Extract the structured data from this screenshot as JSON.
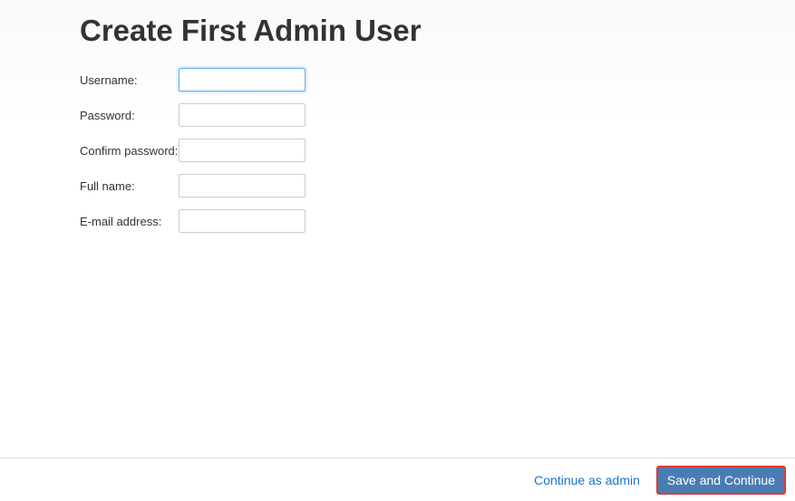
{
  "header": {
    "title": "Create First Admin User"
  },
  "form": {
    "fields": [
      {
        "label": "Username:",
        "value": "",
        "focused": true
      },
      {
        "label": "Password:",
        "value": "",
        "focused": false
      },
      {
        "label": "Confirm password:",
        "value": "",
        "focused": false
      },
      {
        "label": "Full name:",
        "value": "",
        "focused": false
      },
      {
        "label": "E-mail address:",
        "value": "",
        "focused": false
      }
    ]
  },
  "footer": {
    "continue_link": "Continue as admin",
    "save_button": "Save and Continue"
  }
}
